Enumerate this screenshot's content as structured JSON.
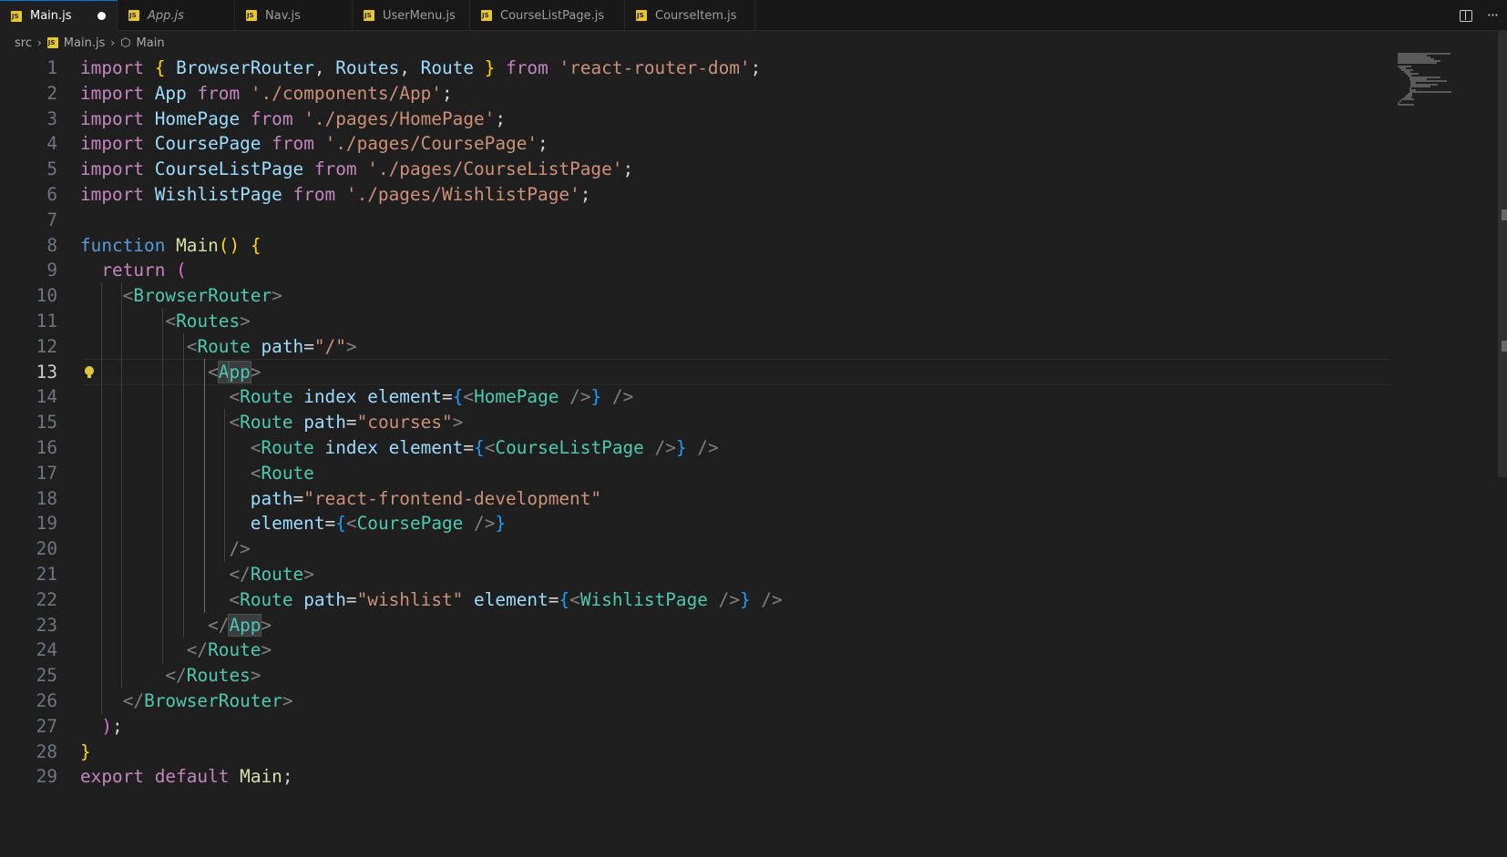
{
  "tabs": [
    {
      "label": "Main.js",
      "active": true,
      "dirty": true
    },
    {
      "label": "App.js",
      "italic": true
    },
    {
      "label": "Nav.js"
    },
    {
      "label": "UserMenu.js"
    },
    {
      "label": "CourseListPage.js"
    },
    {
      "label": "CourseItem.js"
    }
  ],
  "tab_actions": {
    "split": "split-editor-icon",
    "more": "···"
  },
  "breadcrumb": {
    "folder": "src",
    "file": "Main.js",
    "symbol": "Main"
  },
  "editor": {
    "current_line": 13,
    "lines": [
      {
        "n": "1",
        "tokens": [
          [
            "kw",
            "import"
          ],
          [
            "pn",
            " "
          ],
          [
            "b1",
            "{"
          ],
          [
            "pn",
            " "
          ],
          [
            "id",
            "BrowserRouter"
          ],
          [
            "pn",
            ", "
          ],
          [
            "id",
            "Routes"
          ],
          [
            "pn",
            ", "
          ],
          [
            "id",
            "Route"
          ],
          [
            "pn",
            " "
          ],
          [
            "b1",
            "}"
          ],
          [
            "pn",
            " "
          ],
          [
            "kw",
            "from"
          ],
          [
            "pn",
            " "
          ],
          [
            "str",
            "'react-router-dom'"
          ],
          [
            "pn",
            ";"
          ]
        ]
      },
      {
        "n": "2",
        "tokens": [
          [
            "kw",
            "import"
          ],
          [
            "pn",
            " "
          ],
          [
            "id",
            "App"
          ],
          [
            "pn",
            " "
          ],
          [
            "kw",
            "from"
          ],
          [
            "pn",
            " "
          ],
          [
            "str",
            "'./components/App'"
          ],
          [
            "pn",
            ";"
          ]
        ]
      },
      {
        "n": "3",
        "tokens": [
          [
            "kw",
            "import"
          ],
          [
            "pn",
            " "
          ],
          [
            "id",
            "HomePage"
          ],
          [
            "pn",
            " "
          ],
          [
            "kw",
            "from"
          ],
          [
            "pn",
            " "
          ],
          [
            "str",
            "'./pages/HomePage'"
          ],
          [
            "pn",
            ";"
          ]
        ]
      },
      {
        "n": "4",
        "tokens": [
          [
            "kw",
            "import"
          ],
          [
            "pn",
            " "
          ],
          [
            "id",
            "CoursePage"
          ],
          [
            "pn",
            " "
          ],
          [
            "kw",
            "from"
          ],
          [
            "pn",
            " "
          ],
          [
            "str",
            "'./pages/CoursePage'"
          ],
          [
            "pn",
            ";"
          ]
        ]
      },
      {
        "n": "5",
        "tokens": [
          [
            "kw",
            "import"
          ],
          [
            "pn",
            " "
          ],
          [
            "id",
            "CourseListPage"
          ],
          [
            "pn",
            " "
          ],
          [
            "kw",
            "from"
          ],
          [
            "pn",
            " "
          ],
          [
            "str",
            "'./pages/CourseListPage'"
          ],
          [
            "pn",
            ";"
          ]
        ]
      },
      {
        "n": "6",
        "tokens": [
          [
            "kw",
            "import"
          ],
          [
            "pn",
            " "
          ],
          [
            "id",
            "WishlistPage"
          ],
          [
            "pn",
            " "
          ],
          [
            "kw",
            "from"
          ],
          [
            "pn",
            " "
          ],
          [
            "str",
            "'./pages/WishlistPage'"
          ],
          [
            "pn",
            ";"
          ]
        ]
      },
      {
        "n": "7",
        "tokens": []
      },
      {
        "n": "8",
        "tokens": [
          [
            "kb",
            "function"
          ],
          [
            "pn",
            " "
          ],
          [
            "fn",
            "Main"
          ],
          [
            "b1",
            "()"
          ],
          [
            "pn",
            " "
          ],
          [
            "b1",
            "{"
          ]
        ]
      },
      {
        "n": "9",
        "tokens": [
          [
            "pn",
            "  "
          ],
          [
            "kw",
            "return"
          ],
          [
            "pn",
            " "
          ],
          [
            "b2",
            "("
          ]
        ]
      },
      {
        "n": "10",
        "tokens": [
          [
            "pn",
            "    "
          ],
          [
            "ang",
            "<"
          ],
          [
            "tag",
            "BrowserRouter"
          ],
          [
            "ang",
            ">"
          ]
        ]
      },
      {
        "n": "11",
        "tokens": [
          [
            "pn",
            "        "
          ],
          [
            "ang",
            "<"
          ],
          [
            "tag",
            "Routes"
          ],
          [
            "ang",
            ">"
          ]
        ]
      },
      {
        "n": "12",
        "tokens": [
          [
            "pn",
            "          "
          ],
          [
            "ang",
            "<"
          ],
          [
            "tag",
            "Route"
          ],
          [
            "pn",
            " "
          ],
          [
            "attr",
            "path"
          ],
          [
            "pn",
            "="
          ],
          [
            "str",
            "\"/\""
          ],
          [
            "ang",
            ">"
          ]
        ]
      },
      {
        "n": "13",
        "tokens": [
          [
            "pn",
            "            "
          ],
          [
            "ang",
            "<"
          ],
          [
            "hl",
            "A"
          ],
          [
            "caret",
            ""
          ],
          [
            "hl",
            "pp"
          ],
          [
            "ang",
            ">"
          ]
        ]
      },
      {
        "n": "14",
        "tokens": [
          [
            "pn",
            "              "
          ],
          [
            "ang",
            "<"
          ],
          [
            "tag",
            "Route"
          ],
          [
            "pn",
            " "
          ],
          [
            "attr",
            "index"
          ],
          [
            "pn",
            " "
          ],
          [
            "attr",
            "element"
          ],
          [
            "pn",
            "="
          ],
          [
            "b3",
            "{"
          ],
          [
            "ang",
            "<"
          ],
          [
            "tag",
            "HomePage"
          ],
          [
            "pn",
            " "
          ],
          [
            "ang",
            "/>"
          ],
          [
            "b3",
            "}"
          ],
          [
            "pn",
            " "
          ],
          [
            "ang",
            "/>"
          ]
        ]
      },
      {
        "n": "15",
        "tokens": [
          [
            "pn",
            "              "
          ],
          [
            "ang",
            "<"
          ],
          [
            "tag",
            "Route"
          ],
          [
            "pn",
            " "
          ],
          [
            "attr",
            "path"
          ],
          [
            "pn",
            "="
          ],
          [
            "str",
            "\"courses\""
          ],
          [
            "ang",
            ">"
          ]
        ]
      },
      {
        "n": "16",
        "tokens": [
          [
            "pn",
            "                "
          ],
          [
            "ang",
            "<"
          ],
          [
            "tag",
            "Route"
          ],
          [
            "pn",
            " "
          ],
          [
            "attr",
            "index"
          ],
          [
            "pn",
            " "
          ],
          [
            "attr",
            "element"
          ],
          [
            "pn",
            "="
          ],
          [
            "b3",
            "{"
          ],
          [
            "ang",
            "<"
          ],
          [
            "tag",
            "CourseListPage"
          ],
          [
            "pn",
            " "
          ],
          [
            "ang",
            "/>"
          ],
          [
            "b3",
            "}"
          ],
          [
            "pn",
            " "
          ],
          [
            "ang",
            "/>"
          ]
        ]
      },
      {
        "n": "17",
        "tokens": [
          [
            "pn",
            "                "
          ],
          [
            "ang",
            "<"
          ],
          [
            "tag",
            "Route"
          ]
        ]
      },
      {
        "n": "18",
        "tokens": [
          [
            "pn",
            "                "
          ],
          [
            "attr",
            "path"
          ],
          [
            "pn",
            "="
          ],
          [
            "str",
            "\"react-frontend-development\""
          ]
        ]
      },
      {
        "n": "19",
        "tokens": [
          [
            "pn",
            "                "
          ],
          [
            "attr",
            "element"
          ],
          [
            "pn",
            "="
          ],
          [
            "b3",
            "{"
          ],
          [
            "ang",
            "<"
          ],
          [
            "tag",
            "CoursePage"
          ],
          [
            "pn",
            " "
          ],
          [
            "ang",
            "/>"
          ],
          [
            "b3",
            "}"
          ]
        ]
      },
      {
        "n": "20",
        "tokens": [
          [
            "pn",
            "              "
          ],
          [
            "ang",
            "/>"
          ]
        ]
      },
      {
        "n": "21",
        "tokens": [
          [
            "pn",
            "              "
          ],
          [
            "ang",
            "</"
          ],
          [
            "tag",
            "Route"
          ],
          [
            "ang",
            ">"
          ]
        ]
      },
      {
        "n": "22",
        "tokens": [
          [
            "pn",
            "              "
          ],
          [
            "ang",
            "<"
          ],
          [
            "tag",
            "Route"
          ],
          [
            "pn",
            " "
          ],
          [
            "attr",
            "path"
          ],
          [
            "pn",
            "="
          ],
          [
            "str",
            "\"wishlist\""
          ],
          [
            "pn",
            " "
          ],
          [
            "attr",
            "element"
          ],
          [
            "pn",
            "="
          ],
          [
            "b3",
            "{"
          ],
          [
            "ang",
            "<"
          ],
          [
            "tag",
            "WishlistPage"
          ],
          [
            "pn",
            " "
          ],
          [
            "ang",
            "/>"
          ],
          [
            "b3",
            "}"
          ],
          [
            "pn",
            " "
          ],
          [
            "ang",
            "/>"
          ]
        ]
      },
      {
        "n": "23",
        "tokens": [
          [
            "pn",
            "            "
          ],
          [
            "ang",
            "</"
          ],
          [
            "hl",
            "App"
          ],
          [
            "ang",
            ">"
          ]
        ]
      },
      {
        "n": "24",
        "tokens": [
          [
            "pn",
            "          "
          ],
          [
            "ang",
            "</"
          ],
          [
            "tag",
            "Route"
          ],
          [
            "ang",
            ">"
          ]
        ]
      },
      {
        "n": "25",
        "tokens": [
          [
            "pn",
            "        "
          ],
          [
            "ang",
            "</"
          ],
          [
            "tag",
            "Routes"
          ],
          [
            "ang",
            ">"
          ]
        ]
      },
      {
        "n": "26",
        "tokens": [
          [
            "pn",
            "    "
          ],
          [
            "ang",
            "</"
          ],
          [
            "tag",
            "BrowserRouter"
          ],
          [
            "ang",
            ">"
          ]
        ]
      },
      {
        "n": "27",
        "tokens": [
          [
            "pn",
            "  "
          ],
          [
            "b2",
            ")"
          ],
          [
            "pn",
            ";"
          ]
        ]
      },
      {
        "n": "28",
        "tokens": [
          [
            "b1",
            "}"
          ]
        ]
      },
      {
        "n": "29",
        "tokens": [
          [
            "kw",
            "export"
          ],
          [
            "pn",
            " "
          ],
          [
            "kw",
            "default"
          ],
          [
            "pn",
            " "
          ],
          [
            "fn",
            "Main"
          ],
          [
            "pn",
            ";"
          ]
        ]
      }
    ]
  }
}
